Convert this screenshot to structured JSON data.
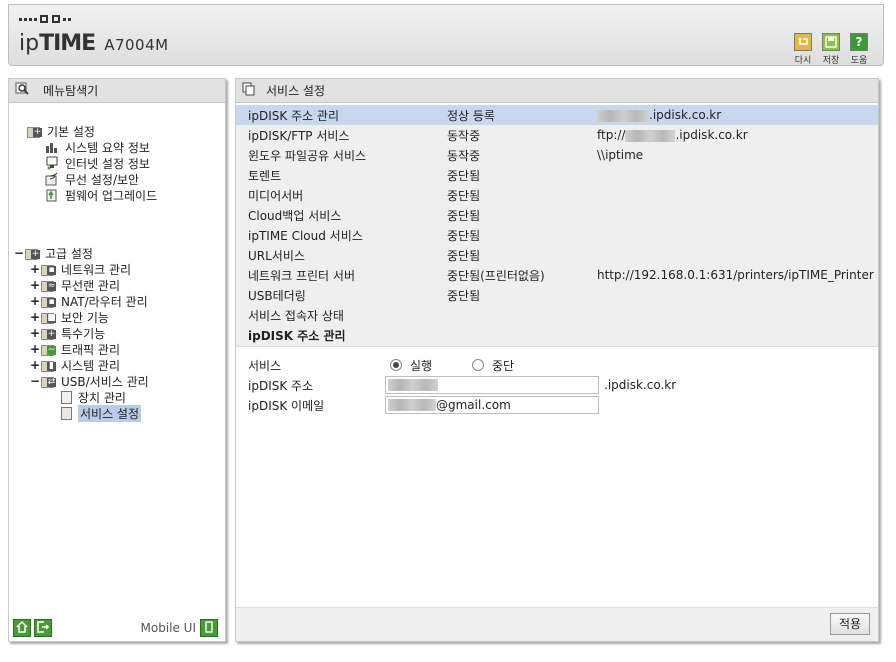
{
  "header": {
    "brand_ip": "ip",
    "brand_time": "TIME",
    "model": "A7004M",
    "buttons": [
      {
        "label": "다시",
        "icon": "undo-icon",
        "color": "#e3b84a"
      },
      {
        "label": "저장",
        "icon": "save-icon",
        "color": "#8cc24a"
      },
      {
        "label": "도움",
        "icon": "help-icon",
        "color": "#3a9a3a"
      }
    ],
    "help_glyph": "?"
  },
  "sidebar": {
    "title": "메뉴탐색기",
    "basic": {
      "label": "기본 설정",
      "items": [
        "시스템 요약 정보",
        "인터넷 설정 정보",
        "무선 설정/보안",
        "펌웨어 업그레이드"
      ]
    },
    "advanced": {
      "label": "고급 설정",
      "expander": "−",
      "items": [
        {
          "label": "네트워크 관리",
          "expander": "+"
        },
        {
          "label": "무선랜 관리",
          "expander": "+"
        },
        {
          "label": "NAT/라우터 관리",
          "expander": "+"
        },
        {
          "label": "보안 기능",
          "expander": "+"
        },
        {
          "label": "특수기능",
          "expander": "+"
        },
        {
          "label": "트래픽 관리",
          "expander": "+"
        },
        {
          "label": "시스템 관리",
          "expander": "+"
        },
        {
          "label": "USB/서비스 관리",
          "expander": "−"
        }
      ],
      "usb_children": [
        "장치 관리",
        "서비스 설정"
      ]
    },
    "footer": {
      "mobile_label": "Mobile UI"
    }
  },
  "main": {
    "title": "서비스 설정",
    "services": [
      {
        "name": "ipDISK 주소 관리",
        "status": "정상 등록",
        "info_suffix": ".ipdisk.co.kr",
        "info_prefix": "",
        "blurred": true,
        "selected": true
      },
      {
        "name": "ipDISK/FTP 서비스",
        "status": "동작중",
        "info_prefix": "ftp://",
        "info_suffix": ".ipdisk.co.kr",
        "blurred": true,
        "selected": false
      },
      {
        "name": "윈도우 파일공유 서비스",
        "status": "동작중",
        "info_prefix": "\\\\iptime",
        "info_suffix": "",
        "blurred": false,
        "selected": false
      },
      {
        "name": "토렌트",
        "status": "중단됨",
        "info_prefix": "",
        "info_suffix": "",
        "blurred": false,
        "selected": false
      },
      {
        "name": "미디어서버",
        "status": "중단됨",
        "info_prefix": "",
        "info_suffix": "",
        "blurred": false,
        "selected": false
      },
      {
        "name": "Cloud백업 서비스",
        "status": "중단됨",
        "info_prefix": "",
        "info_suffix": "",
        "blurred": false,
        "selected": false
      },
      {
        "name": "ipTIME Cloud 서비스",
        "status": "중단됨",
        "info_prefix": "",
        "info_suffix": "",
        "blurred": false,
        "selected": false
      },
      {
        "name": "URL서비스",
        "status": "중단됨",
        "info_prefix": "",
        "info_suffix": "",
        "blurred": false,
        "selected": false
      },
      {
        "name": "네트워크 프린터 서버",
        "status": "중단됨(프린터없음)",
        "info_prefix": "http://192.168.0.1:631/printers/ipTIME_Printer",
        "info_suffix": "",
        "blurred": false,
        "selected": false
      },
      {
        "name": "USB테더링",
        "status": "중단됨",
        "info_prefix": "",
        "info_suffix": "",
        "blurred": false,
        "selected": false
      },
      {
        "name": "서비스 접속자 상태",
        "status": "",
        "info_prefix": "",
        "info_suffix": "",
        "blurred": false,
        "selected": false
      }
    ],
    "section_title": "ipDISK 주소 관리",
    "form": {
      "service_label": "서비스",
      "run_label": "실행",
      "stop_label": "중단",
      "selected": "run",
      "address_label": "ipDISK 주소",
      "address_suffix": ".ipdisk.co.kr",
      "email_label": "ipDISK 이메일",
      "email_domain": "@gmail.com"
    },
    "apply_label": "적용"
  }
}
